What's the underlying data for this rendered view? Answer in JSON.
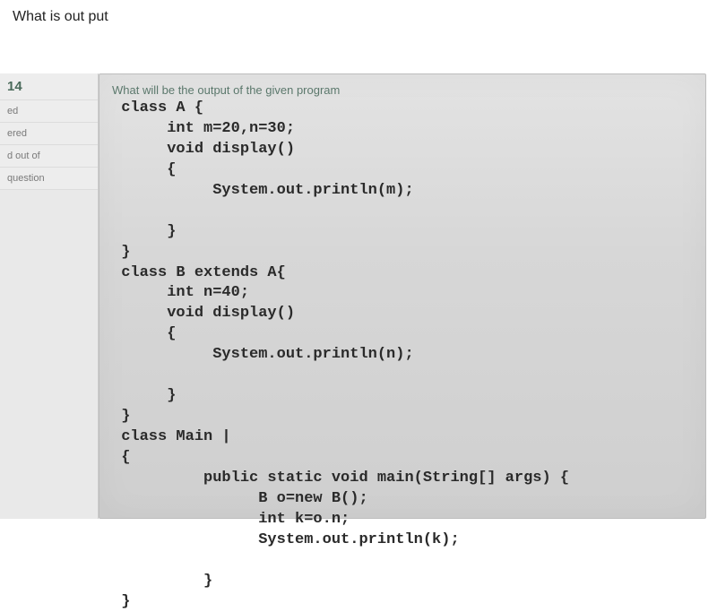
{
  "page": {
    "title": "What is out put"
  },
  "sidebar": {
    "items": [
      {
        "label": "14"
      },
      {
        "label": "ed"
      },
      {
        "label": "ered"
      },
      {
        "label": "d out of"
      },
      {
        "label": "question"
      }
    ]
  },
  "question": {
    "prompt": "What will be the output of the given program",
    "code": " class A {\n      int m=20,n=30;\n      void display()\n      {\n           System.out.println(m);\n\n      }\n }\n class B extends A{\n      int n=40;\n      void display()\n      {\n           System.out.println(n);\n\n      }\n }\n class Main |\n {\n          public static void main(String[] args) {\n                B o=new B();\n                int k=o.n;\n                System.out.println(k);\n\n          }\n }"
  }
}
